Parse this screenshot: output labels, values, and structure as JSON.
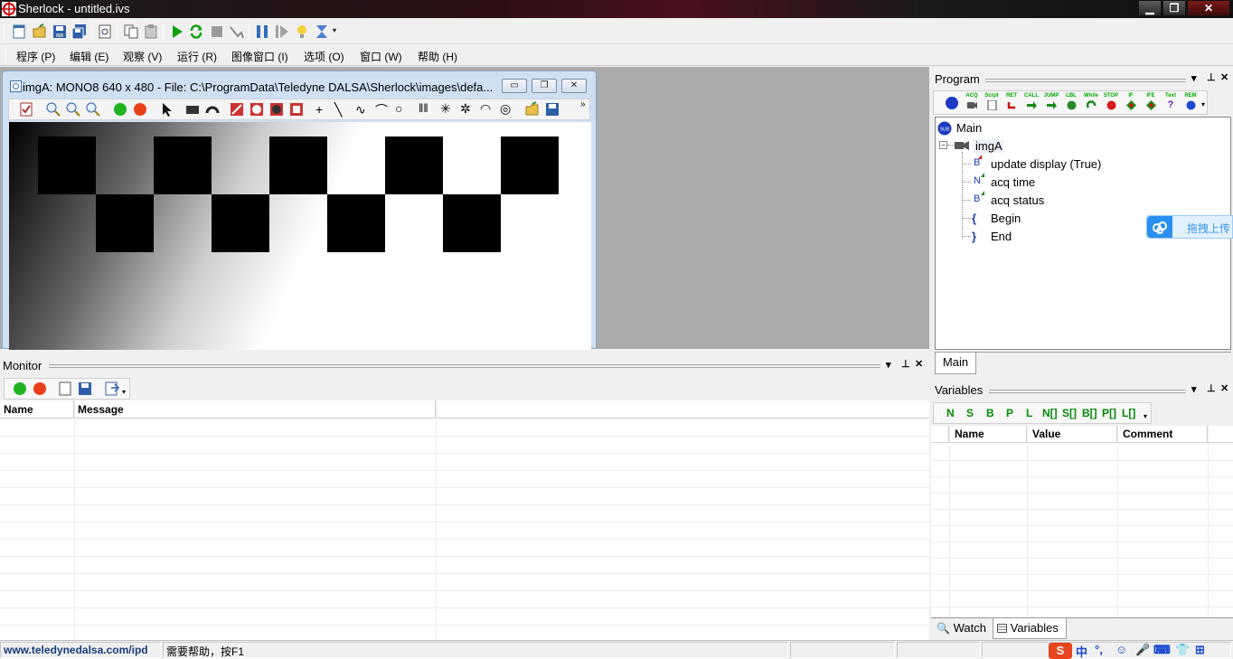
{
  "window": {
    "title": "Sherlock - untitled.ivs",
    "minimize": "▁",
    "maximize": "❐",
    "close": "✕"
  },
  "menu": [
    "程序 (P)",
    "编辑 (E)",
    "观察 (V)",
    "运行 (R)",
    "图像窗口 (I)",
    "选项 (O)",
    "窗口 (W)",
    "帮助 (H)"
  ],
  "image_window": {
    "title": "imgA: MONO8 640 x 480 - File: C:\\ProgramData\\Teledyne DALSA\\Sherlock\\images\\defa...",
    "minimize": "▭",
    "restore": "❐",
    "close": "✕"
  },
  "program": {
    "caption": "Program",
    "toolbar_labels": [
      "SUB",
      "ACQ",
      "Scrpt",
      "RET",
      "CALL",
      "JUMP",
      "LBL",
      "While",
      "STOP",
      "IF",
      "IFE",
      "Text",
      "REM"
    ],
    "tree": {
      "main": "Main",
      "image": "imgA",
      "items": [
        {
          "badge": "B",
          "label": "update display (True)"
        },
        {
          "badge": "N",
          "label": "acq time"
        },
        {
          "badge": "B",
          "label": "acq status"
        },
        {
          "badge": "{",
          "label": "Begin"
        },
        {
          "badge": "}",
          "label": "End"
        }
      ]
    },
    "tab": "Main"
  },
  "upload_widget": {
    "label": "拖拽上传"
  },
  "variables": {
    "caption": "Variables",
    "toolbar": [
      "N",
      "S",
      "B",
      "P",
      "L",
      "N[]",
      "S[]",
      "B[]",
      "P[]",
      "L[]"
    ],
    "columns": [
      "Name",
      "Value",
      "Comment"
    ],
    "tabs": [
      "Watch",
      "Variables"
    ]
  },
  "monitor": {
    "caption": "Monitor",
    "columns": [
      "Name",
      "Message"
    ]
  },
  "status": {
    "link": "www.teledynedalsa.com/ipd",
    "help": "需要帮助，按F1"
  },
  "colors": {
    "workspace": "#ababab",
    "mdi_frame": "#cfe0f3",
    "accent_green": "#078a07",
    "link_blue": "#1a3a7a"
  }
}
